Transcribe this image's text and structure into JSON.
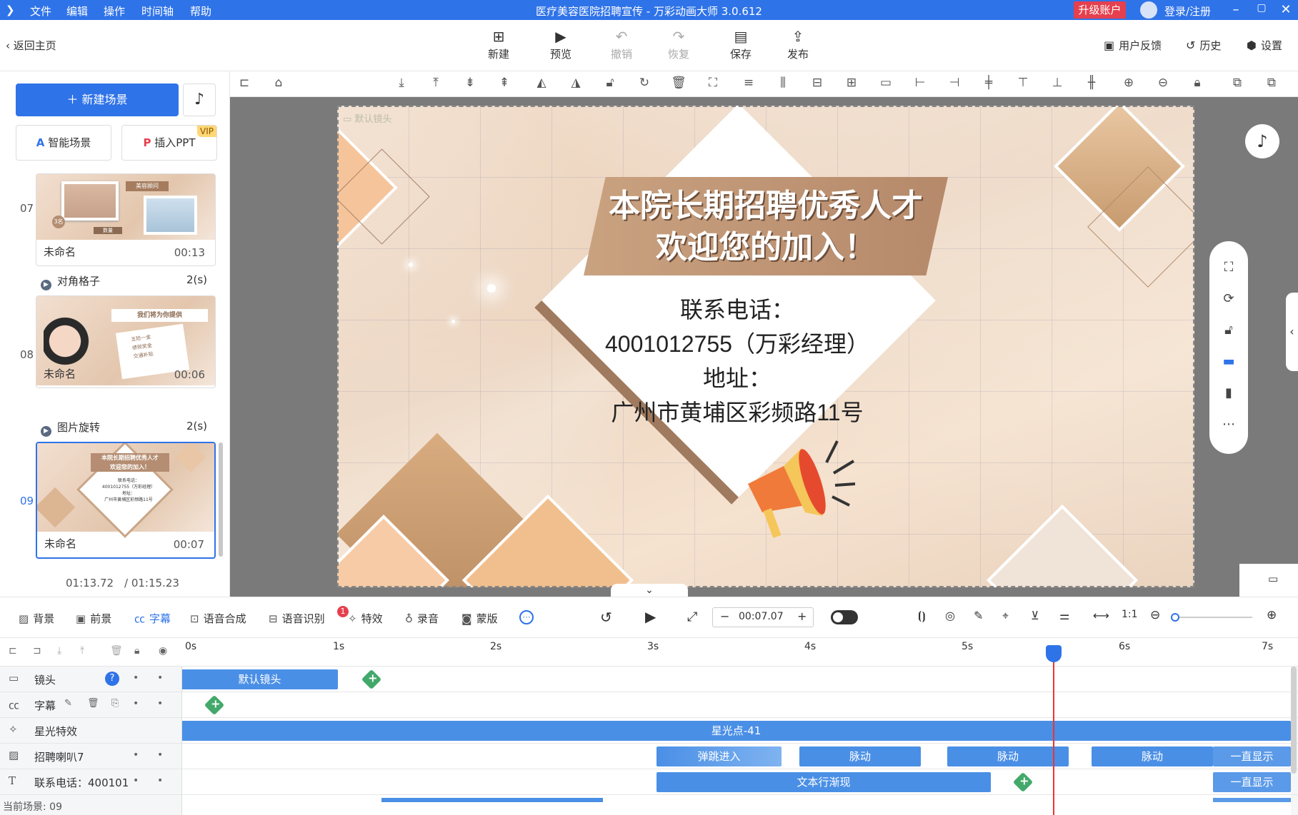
{
  "titlebar": {
    "menu": [
      "文件",
      "编辑",
      "操作",
      "时间轴",
      "帮助"
    ],
    "title": "医疗美容医院招聘宣传 - 万彩动画大师 3.0.612",
    "upgrade": "升级账户",
    "login": "登录/注册",
    "colors": {
      "bar": "#2f73e8",
      "upgrade": "#e5404f"
    }
  },
  "toolbar": {
    "back": "返回主页",
    "buttons": [
      {
        "label": "新建",
        "icon": "plus-square-icon"
      },
      {
        "label": "预览",
        "icon": "play-icon"
      },
      {
        "label": "撤销",
        "icon": "undo-icon"
      },
      {
        "label": "恢复",
        "icon": "redo-icon"
      },
      {
        "label": "保存",
        "icon": "save-icon"
      },
      {
        "label": "发布",
        "icon": "publish-icon"
      }
    ],
    "right": [
      {
        "label": "用户反馈",
        "icon": "feedback-icon"
      },
      {
        "label": "历史",
        "icon": "history-icon"
      },
      {
        "label": "设置",
        "icon": "gear-icon"
      }
    ]
  },
  "left": {
    "new_scene": "新建场景",
    "smart_scene": "智能场景",
    "insert_ppt": "插入PPT",
    "vip": "VIP",
    "scenes": [
      {
        "num": "07",
        "name": "未命名",
        "dur": "00:13",
        "thumb_titles": [
          "美容顾问",
          "3名",
          "数量"
        ]
      },
      {
        "num": "08",
        "name": "未命名",
        "dur": "00:06",
        "thumb_titles": [
          "我们将为你提供",
          "五险一金",
          "绩效奖金",
          "交通补贴"
        ]
      },
      {
        "num": "09",
        "name": "未命名",
        "dur": "00:07"
      }
    ],
    "transitions": [
      {
        "name": "对角格子",
        "dur": "2(s)"
      },
      {
        "name": "图片旋转",
        "dur": "2(s)"
      }
    ],
    "time_current": "01:13.72",
    "time_total": "/ 01:15.23"
  },
  "stage": {
    "camera_label": "默认镜头",
    "banner_line1": "本院长期招聘优秀人才",
    "banner_line2": "欢迎您的加入！",
    "contact_label": "联系电话：",
    "phone": "4001012755（万彩经理）",
    "address_label": "地址：",
    "address": "广州市黄埔区彩频路11号"
  },
  "bottom": {
    "tools": [
      {
        "label": "背景",
        "icon": "background-icon"
      },
      {
        "label": "前景",
        "icon": "foreground-icon"
      },
      {
        "label": "字幕",
        "icon": "subtitle-icon",
        "active": true
      },
      {
        "label": "语音合成",
        "icon": "tts-icon"
      },
      {
        "label": "语音识别",
        "icon": "asr-icon"
      },
      {
        "label": "特效",
        "icon": "effects-icon"
      },
      {
        "label": "录音",
        "icon": "mic-icon"
      },
      {
        "label": "蒙版",
        "icon": "mask-icon"
      }
    ],
    "badge": "1",
    "time_input": "00:07.07"
  },
  "timeline": {
    "ticks": [
      "0s",
      "1s",
      "2s",
      "3s",
      "4s",
      "5s",
      "6s",
      "7s"
    ],
    "rows": [
      {
        "name": "镜头",
        "clips": [
          "默认镜头"
        ]
      },
      {
        "name": "字幕",
        "clips": []
      },
      {
        "name": "星光特效",
        "clips": [
          "星光点-41"
        ]
      },
      {
        "name": "招聘喇叭7",
        "clips": [
          "弹跳进入",
          "脉动",
          "脉动",
          "脉动",
          "一直显示"
        ]
      },
      {
        "name": "联系电话：400101",
        "clips": [
          "文本行渐现",
          "一直显示"
        ]
      }
    ],
    "current_scene": "当前场景: 09"
  }
}
